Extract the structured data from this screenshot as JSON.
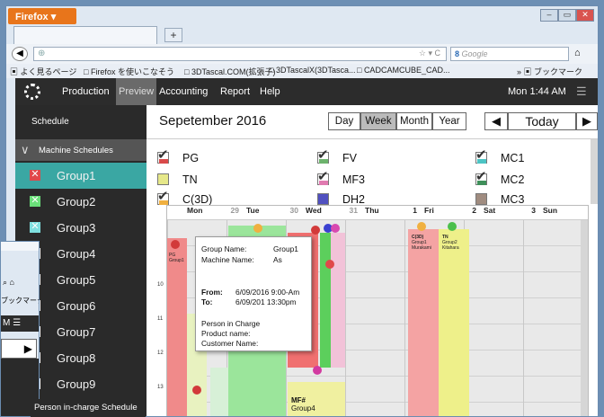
{
  "browser": {
    "button_label": "Firefox",
    "new_tab": "+",
    "search_placeholder": "Google",
    "bookmarks": [
      "よく見るページ",
      "Firefox を使いこなそう",
      "3DTascal.COM(拡張子)",
      "3DTascalX(3DTasca...",
      "CADCAMCUBE_CAD..."
    ],
    "bookmark_menu": "ブックマーク"
  },
  "app": {
    "nav": [
      "Production",
      "Preview",
      "Accounting",
      "Report",
      "Help"
    ],
    "active_nav": "Preview",
    "clock": "Mon 1:44 AM"
  },
  "sidebar": {
    "schedule": "Schedule",
    "machine_schedules": "Machine Schedules",
    "groups": [
      {
        "label": "Group1",
        "color": "#e0484a"
      },
      {
        "label": "Group2",
        "color": "#6be07a"
      },
      {
        "label": "Group3",
        "color": "#7fe0e0"
      },
      {
        "label": "Group4",
        "color": "#ffffff"
      },
      {
        "label": "Group5",
        "color": "#ffffff"
      },
      {
        "label": "Group6",
        "color": "#ffffff"
      },
      {
        "label": "Group7",
        "color": "#ffffff"
      },
      {
        "label": "Group8",
        "color": "#ffffff"
      },
      {
        "label": "Group9",
        "color": "#ffffff"
      }
    ],
    "person_in_charge": "Person in-charge Schedule"
  },
  "toolbar": {
    "month": "Sepetember 2016",
    "views": [
      "Day",
      "Week",
      "Month",
      "Year"
    ],
    "active_view": "Week",
    "prev": "◀",
    "today": "Today",
    "next": "▶"
  },
  "legend": [
    {
      "label": "PG",
      "color": "#d94a4a",
      "checked": true
    },
    {
      "label": "FV",
      "color": "#6db36d",
      "checked": true
    },
    {
      "label": "MC1",
      "color": "#4cc4c4",
      "checked": true
    },
    {
      "label": "TN",
      "color": "#e6e88a",
      "checked": false
    },
    {
      "label": "MF3",
      "color": "#e07ab0",
      "checked": true
    },
    {
      "label": "MC2",
      "color": "#3f8f5a",
      "checked": true
    },
    {
      "label": "C(3D)",
      "color": "#f0b040",
      "checked": true
    },
    {
      "label": "DH2",
      "color": "#5050c0",
      "checked": false
    },
    {
      "label": "MC3",
      "color": "#a08c80",
      "checked": false
    }
  ],
  "calendar": {
    "days": [
      {
        "name": "Mon",
        "date": "29"
      },
      {
        "name": "Tue",
        "date": "30"
      },
      {
        "name": "Wed",
        "date": "31"
      },
      {
        "name": "Thu",
        "date": "1"
      },
      {
        "name": "Fri",
        "date": "2"
      },
      {
        "name": "Sat",
        "date": "3"
      },
      {
        "name": "Sun",
        "date": "4"
      }
    ],
    "hours": [
      "10",
      "11",
      "12",
      "13",
      "14"
    ],
    "event_fri1": [
      "C(3D)",
      "Group1",
      "Murakami"
    ],
    "event_fri2": [
      "TN",
      "Group2",
      "Kitahara"
    ],
    "event_wed": [
      "MF#",
      "Group4"
    ],
    "event_mon": [
      "PG",
      "Group1"
    ]
  },
  "popup": {
    "group_label": "Group Name:",
    "group_value": "Group1",
    "machine_label": "Machine Name:",
    "machine_value": "As",
    "from_label": "From:",
    "from_value": "6/09/2016  9:00-Am",
    "to_label": "To:",
    "to_value": "6/09/201   13:30pm",
    "person": "Person in Charge",
    "product": "Product name:",
    "customer": "Customer Name:"
  }
}
